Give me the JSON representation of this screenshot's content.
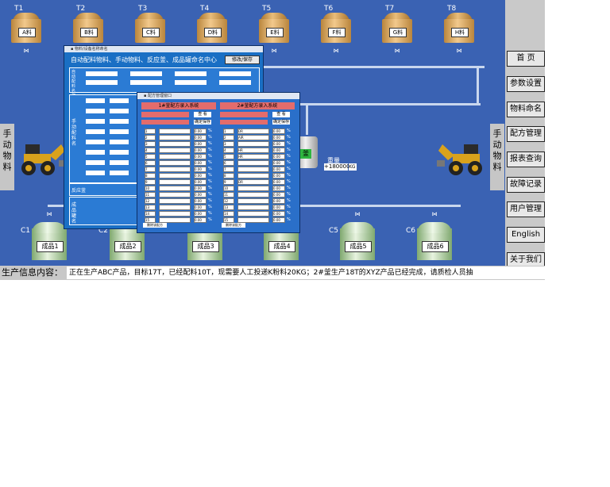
{
  "raw_tanks": [
    {
      "id": "T1",
      "label": "A料"
    },
    {
      "id": "T2",
      "label": "B料"
    },
    {
      "id": "T3",
      "label": "C料"
    },
    {
      "id": "T4",
      "label": "D料"
    },
    {
      "id": "T5",
      "label": "E料"
    },
    {
      "id": "T6",
      "label": "F料"
    },
    {
      "id": "T7",
      "label": "G料"
    },
    {
      "id": "T8",
      "label": "H料"
    }
  ],
  "product_tanks": [
    {
      "id": "C1",
      "label": "成品1"
    },
    {
      "id": "C2",
      "label": "成品2"
    },
    {
      "id": "C3",
      "label": "成品3"
    },
    {
      "id": "C4",
      "label": "成品4"
    },
    {
      "id": "C5",
      "label": "成品5"
    },
    {
      "id": "C6",
      "label": "成品6"
    }
  ],
  "nav": {
    "home": "首 页",
    "params": "参数设置",
    "materials": "物料命名",
    "recipes": "配方管理",
    "reports": "报表查询",
    "faults": "故障记录",
    "users": "用户管理",
    "english": "English",
    "about": "关于我们"
  },
  "side_tabs": {
    "left": "手动物料",
    "right": "手动物料"
  },
  "naming_window": {
    "title": "自动配料物料、手动物料、反应釜、成品罐命名中心",
    "save_button": "修改/保存",
    "section_auto": "自动配料名称",
    "section_manual": "手动配料名",
    "section_reactor": "反应釜",
    "section_product": "成品罐名"
  },
  "reactor": {
    "label": "釜",
    "weight_label": "重量",
    "weight_value": "+180000",
    "unit": "KG"
  },
  "recipe_window": {
    "panel1_title": "1#釜配方录入系统",
    "panel2_title": "2#釜配方录入系统",
    "query_button": "查 看",
    "confirm_button": "确定保存",
    "panel1_footer_btn": "删除该配方",
    "panel2_footer_btn": "删除该配方",
    "panel1_rows": [
      "1",
      "2",
      "3",
      "4",
      "5",
      "6",
      "7",
      "8",
      "9",
      "10",
      "11",
      "12",
      "13",
      "14",
      "15"
    ],
    "panel2_rows": [
      "1",
      "2",
      "3",
      "4",
      "5",
      "6",
      "7",
      "8",
      "9",
      "10",
      "11",
      "12",
      "13",
      "14",
      "15"
    ],
    "panel2_names": [
      "DR",
      "AIR",
      "",
      "HR",
      "HR",
      "",
      "",
      "",
      "DR",
      "",
      "",
      "",
      "",
      "",
      ""
    ],
    "value": "0.00",
    "pct": "%"
  },
  "status": {
    "label": "生产信息内容：",
    "text": "正在生产ABC产品，目标17T，已经配料10T，现需要人工投递K粉料20KG；2#釜生产18T的XYZ产品已经完成，请质检人员抽"
  },
  "colors": {
    "background": "#3a62b3",
    "window": "#1a6fc4",
    "header_red": "#e36c6c"
  }
}
